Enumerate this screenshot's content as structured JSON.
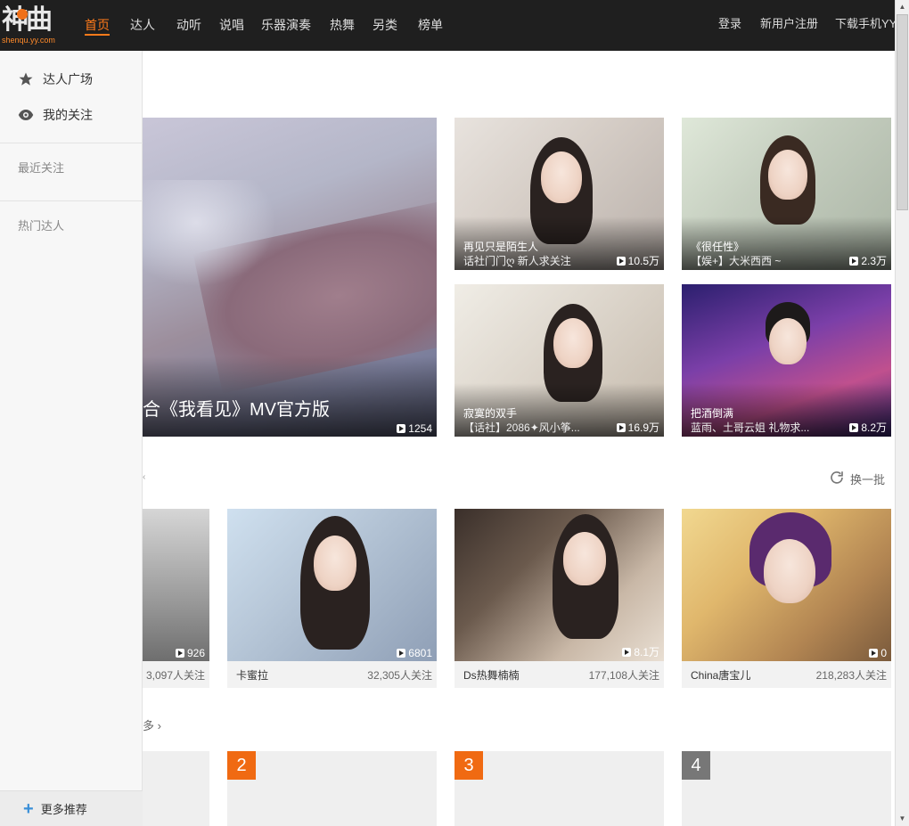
{
  "logo": {
    "mark": "神曲",
    "sub": "shenqu.yy.com"
  },
  "nav": [
    "首页",
    "达人",
    "动听",
    "说唱",
    "乐器演奏",
    "热舞",
    "另类",
    "榜单"
  ],
  "auth": {
    "login": "登录",
    "register": "新用户注册",
    "download": "下载手机YY"
  },
  "sidebar": {
    "items": [
      {
        "label": "达人广场",
        "icon": "star-icon"
      },
      {
        "label": "我的关注",
        "icon": "eye-icon"
      }
    ],
    "recent": "最近关注",
    "hot": "热门达人",
    "more": "更多推荐"
  },
  "featured": {
    "big": {
      "title": "合《我看见》MV官方版",
      "plays": "1254"
    },
    "small": [
      {
        "title": "再见只是陌生人",
        "sub": "话社门门ღ 新人求关注",
        "plays": "10.5万"
      },
      {
        "title": "《很任性》",
        "sub": "【娱+】大米西西 ~",
        "plays": "2.3万"
      },
      {
        "title": "寂寞的双手",
        "sub": "【话社】2086✦风小筝...",
        "plays": "16.9万"
      },
      {
        "title": "把酒倒满",
        "sub": "蓝雨、土哥云姐 礼物求...",
        "plays": "8.2万"
      }
    ]
  },
  "refresh_label": "换一批",
  "stars": [
    {
      "name": "",
      "fans": "3,097人关注",
      "plays": "926"
    },
    {
      "name": "卡蜜拉",
      "fans": "32,305人关注",
      "plays": "6801"
    },
    {
      "name": "Ds热舞楠楠",
      "fans": "177,108人关注",
      "plays": "8.1万"
    },
    {
      "name": "China唐宝儿",
      "fans": "218,283人关注",
      "plays": "0"
    }
  ],
  "more_label": "多 ›",
  "ranks": [
    "2",
    "3",
    "4"
  ],
  "colors": {
    "accent": "#ff7a1a",
    "topbar": "#1f1f1f",
    "rank_gray": "#777777"
  }
}
